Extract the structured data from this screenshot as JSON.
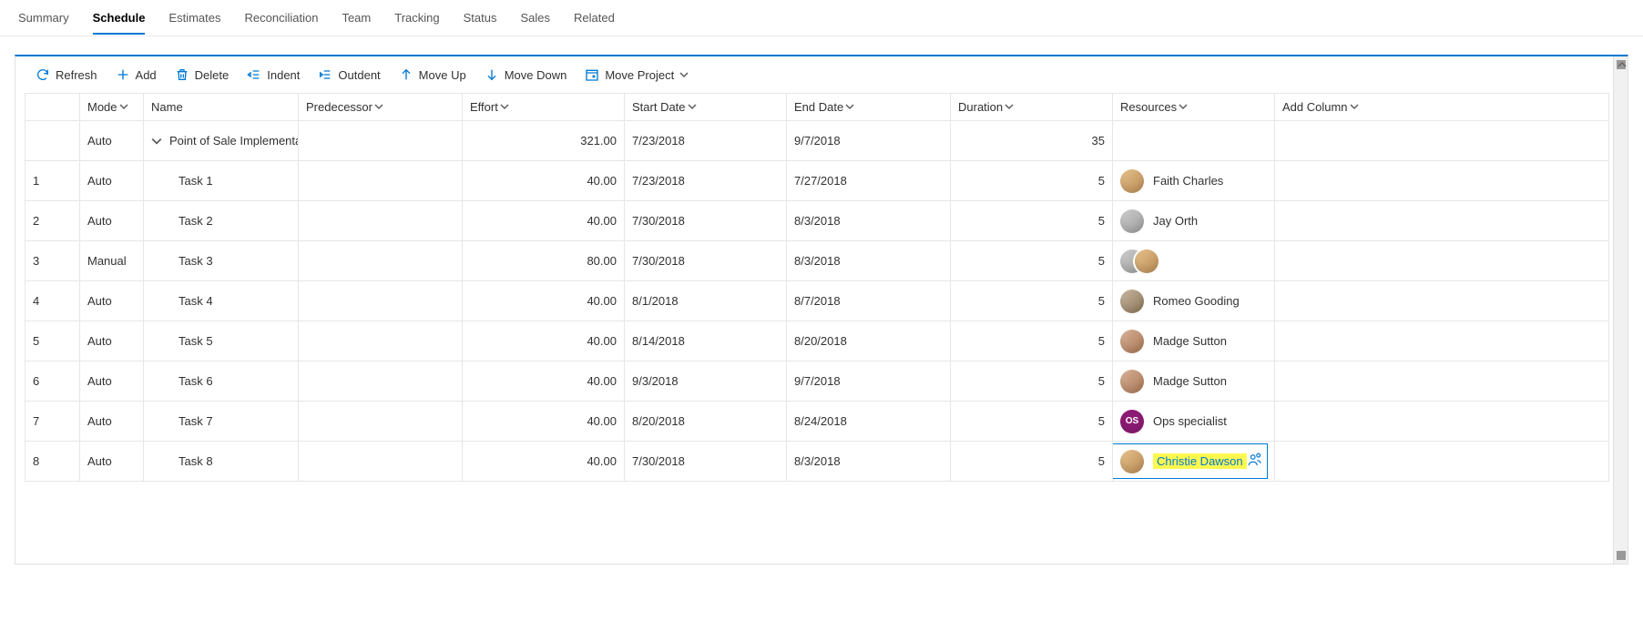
{
  "tabs": [
    "Summary",
    "Schedule",
    "Estimates",
    "Reconciliation",
    "Team",
    "Tracking",
    "Status",
    "Sales",
    "Related"
  ],
  "active_tab": "Schedule",
  "toolbar": {
    "refresh": "Refresh",
    "add": "Add",
    "delete": "Delete",
    "indent": "Indent",
    "outdent": "Outdent",
    "moveup": "Move Up",
    "movedown": "Move Down",
    "moveproject": "Move Project"
  },
  "columns": {
    "mode": "Mode",
    "name": "Name",
    "predecessor": "Predecessor",
    "effort": "Effort",
    "start": "Start Date",
    "end": "End Date",
    "duration": "Duration",
    "resources": "Resources",
    "add": "Add Column"
  },
  "rows": [
    {
      "idx": "",
      "mode": "Auto",
      "name": "Point of Sale Implementat",
      "effort": "321.00",
      "start": "7/23/2018",
      "end": "9/7/2018",
      "duration": "35",
      "resource": "",
      "group": true
    },
    {
      "idx": "1",
      "mode": "Auto",
      "name": "Task 1",
      "effort": "40.00",
      "start": "7/23/2018",
      "end": "7/27/2018",
      "duration": "5",
      "resource": "Faith Charles"
    },
    {
      "idx": "2",
      "mode": "Auto",
      "name": "Task 2",
      "effort": "40.00",
      "start": "7/30/2018",
      "end": "8/3/2018",
      "duration": "5",
      "resource": "Jay Orth"
    },
    {
      "idx": "3",
      "mode": "Manual",
      "name": "Task 3",
      "effort": "80.00",
      "start": "7/30/2018",
      "end": "8/3/2018",
      "duration": "5",
      "resource": "",
      "multi": true
    },
    {
      "idx": "4",
      "mode": "Auto",
      "name": "Task 4",
      "effort": "40.00",
      "start": "8/1/2018",
      "end": "8/7/2018",
      "duration": "5",
      "resource": "Romeo Gooding"
    },
    {
      "idx": "5",
      "mode": "Auto",
      "name": "Task 5",
      "effort": "40.00",
      "start": "8/14/2018",
      "end": "8/20/2018",
      "duration": "5",
      "resource": "Madge Sutton"
    },
    {
      "idx": "6",
      "mode": "Auto",
      "name": "Task 6",
      "effort": "40.00",
      "start": "9/3/2018",
      "end": "9/7/2018",
      "duration": "5",
      "resource": "Madge Sutton"
    },
    {
      "idx": "7",
      "mode": "Auto",
      "name": "Task 7",
      "effort": "40.00",
      "start": "8/20/2018",
      "end": "8/24/2018",
      "duration": "5",
      "resource": "Ops specialist",
      "initials": "OS"
    },
    {
      "idx": "8",
      "mode": "Auto",
      "name": "Task 8",
      "effort": "40.00",
      "start": "7/30/2018",
      "end": "8/3/2018",
      "duration": "5",
      "resource": "Christie Dawson",
      "selected": true
    }
  ]
}
